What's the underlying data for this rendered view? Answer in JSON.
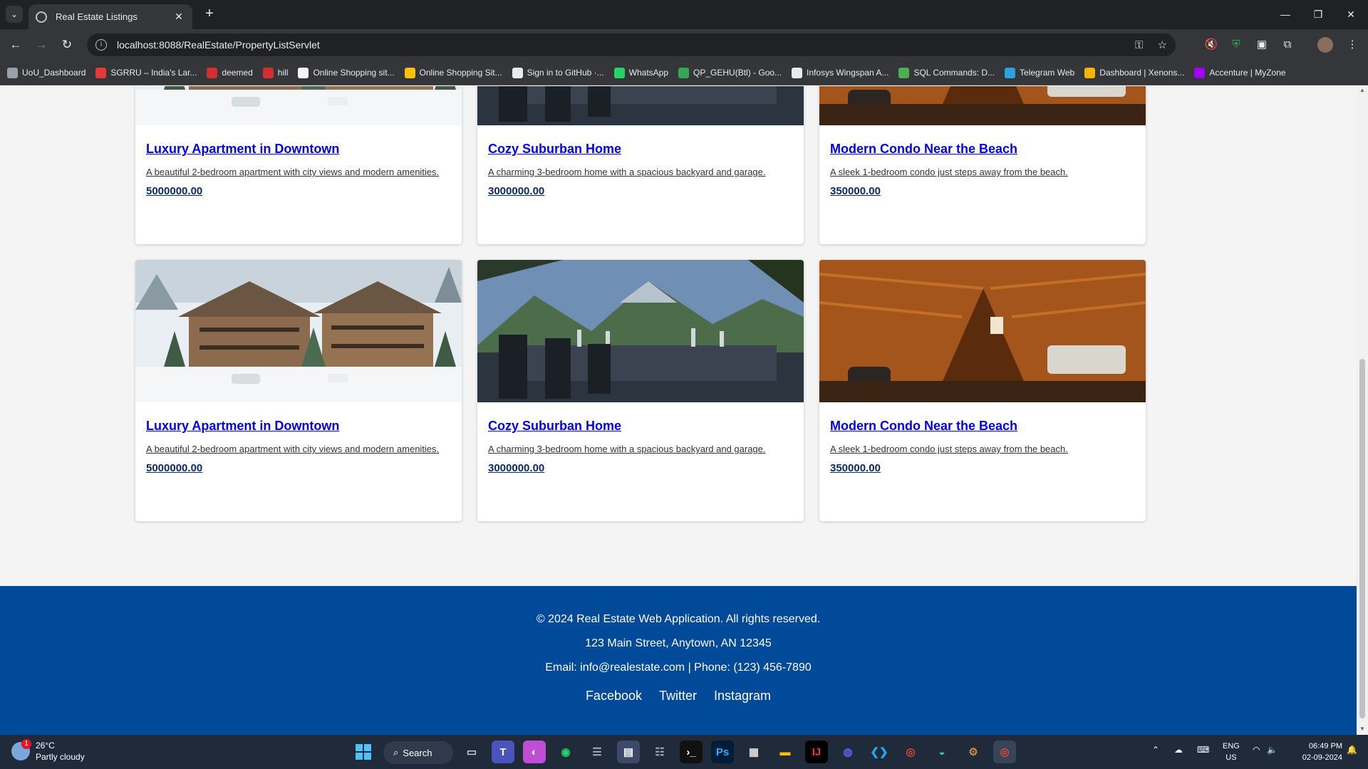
{
  "browser": {
    "tab_title": "Real Estate Listings",
    "url": "localhost:8088/RealEstate/PropertyListServlet",
    "bookmarks": [
      {
        "label": "UoU_Dashboard",
        "color": "#9aa0a6"
      },
      {
        "label": "SGRRU – India's Lar...",
        "color": "#e53935"
      },
      {
        "label": "deemed",
        "color": "#d32f2f"
      },
      {
        "label": "hill",
        "color": "#d32f2f"
      },
      {
        "label": "Online Shopping sit...",
        "color": "#f5f5f5"
      },
      {
        "label": "Online Shopping Sit...",
        "color": "#f9c300"
      },
      {
        "label": "Sign in to GitHub ·...",
        "color": "#e8eaed"
      },
      {
        "label": "WhatsApp",
        "color": "#25d366"
      },
      {
        "label": "QP_GEHU(Btl) - Goo...",
        "color": "#34a853"
      },
      {
        "label": "Infosys Wingspan A...",
        "color": "#e8eaed"
      },
      {
        "label": "SQL Commands: D...",
        "color": "#4caf50"
      },
      {
        "label": "Telegram Web",
        "color": "#2aa3df"
      },
      {
        "label": "Dashboard | Xenons...",
        "color": "#f4b400"
      },
      {
        "label": "Accenture | MyZone",
        "color": "#a100ff"
      }
    ]
  },
  "listings": [
    {
      "title": "Luxury Apartment in Downtown",
      "description": "A beautiful 2-bedroom apartment with city views and modern amenities.",
      "price": "5000000.00",
      "image": "snowy-chalets"
    },
    {
      "title": "Cozy Suburban Home",
      "description": "A charming 3-bedroom home with a spacious backyard and garage.",
      "price": "3000000.00",
      "image": "mountain-terrace-dining"
    },
    {
      "title": "Modern Condo Near the Beach",
      "description": "A sleek 1-bedroom condo just steps away from the beach.",
      "price": "350000.00",
      "image": "wooden-loft-interior"
    },
    {
      "title": "Luxury Apartment in Downtown",
      "description": "A beautiful 2-bedroom apartment with city views and modern amenities.",
      "price": "5000000.00",
      "image": "snowy-chalets"
    },
    {
      "title": "Cozy Suburban Home",
      "description": "A charming 3-bedroom home with a spacious backyard and garage.",
      "price": "3000000.00",
      "image": "mountain-terrace-dining"
    },
    {
      "title": "Modern Condo Near the Beach",
      "description": "A sleek 1-bedroom condo just steps away from the beach.",
      "price": "350000.00",
      "image": "wooden-loft-interior"
    }
  ],
  "footer": {
    "copyright": "© 2024 Real Estate Web Application. All rights reserved.",
    "address": "123 Main Street, Anytown, AN 12345",
    "contact": "Email: info@realestate.com | Phone: (123) 456-7890",
    "links": [
      "Facebook",
      "Twitter",
      "Instagram"
    ],
    "background": "#004a99"
  },
  "taskbar": {
    "weather_temp": "26°C",
    "weather_desc": "Partly cloudy",
    "weather_badge": "1",
    "search_label": "Search",
    "language": "ENG",
    "region": "US",
    "time": "06:49 PM",
    "date": "02-09-2024"
  }
}
